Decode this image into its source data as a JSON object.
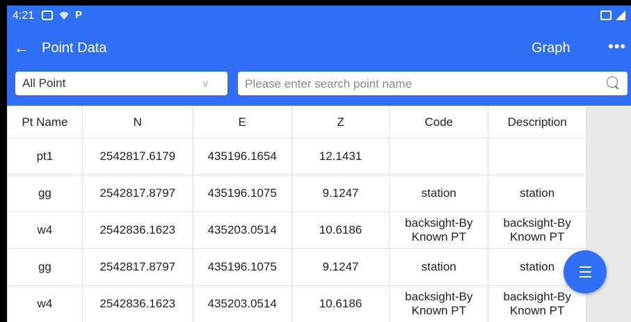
{
  "status": {
    "time": "4:21"
  },
  "appbar": {
    "title": "Point Data",
    "graph_label": "Graph",
    "more_label": "•••"
  },
  "filter": {
    "selected": "All Point",
    "search_placeholder": "Please enter search point name"
  },
  "table": {
    "headers": [
      "Pt Name",
      "N",
      "E",
      "Z",
      "Code",
      "Description"
    ],
    "rows": [
      [
        "pt1",
        "2542817.6179",
        "435196.1654",
        "12.1431",
        "",
        ""
      ],
      [
        "gg",
        "2542817.8797",
        "435196.1075",
        "9.1247",
        "station",
        "station"
      ],
      [
        "w4",
        "2542836.1623",
        "435203.0514",
        "10.6186",
        "backsight-By Known PT",
        "backsight-By Known PT"
      ],
      [
        "gg",
        "2542817.8797",
        "435196.1075",
        "9.1247",
        "station",
        "station"
      ],
      [
        "w4",
        "2542836.1623",
        "435203.0514",
        "10.6186",
        "backsight-By Known PT",
        "backsight-By Known PT"
      ]
    ]
  },
  "colors": {
    "accent": "#2f6ff6"
  }
}
